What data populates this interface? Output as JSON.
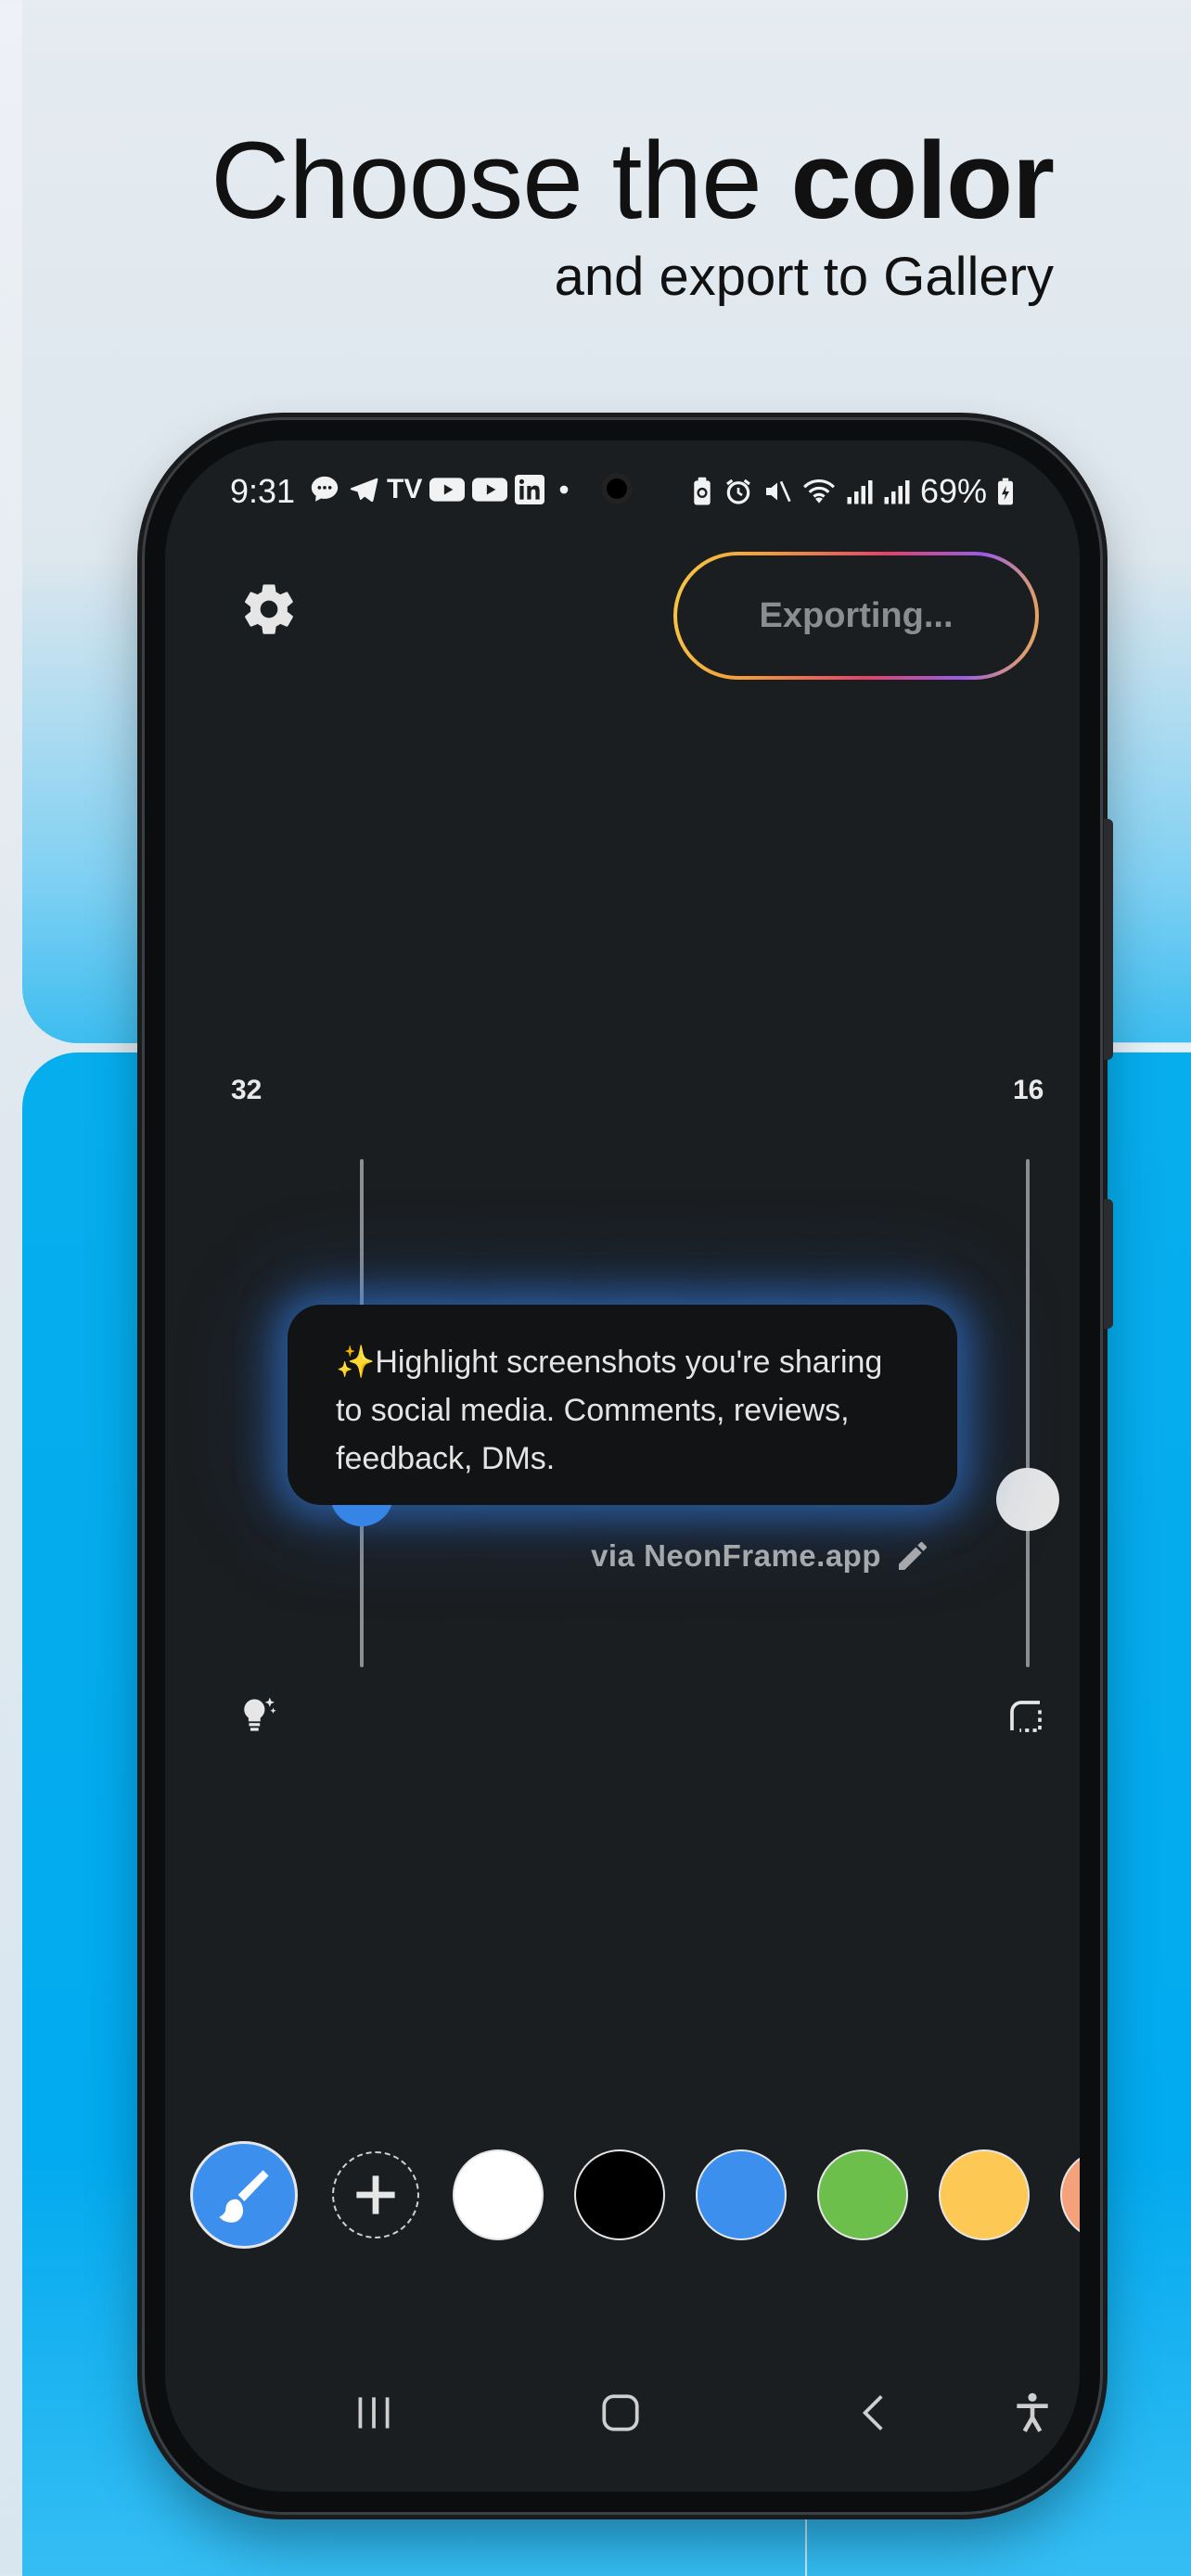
{
  "headline": {
    "line1_regular": "Choose the ",
    "line1_bold": "color",
    "line2": "and export to Gallery"
  },
  "statusbar": {
    "time": "9:31",
    "battery": "69%",
    "left_icons": [
      "chat-icon",
      "telegram-icon",
      "tradingview-icon",
      "youtube-icon",
      "youtube-icon",
      "linkedin-icon",
      "dot-icon"
    ],
    "right_icons": [
      "battery-saver-icon",
      "alarm-icon",
      "mute-icon",
      "wifi-icon",
      "signal-icon",
      "signal-icon",
      "battery-icon"
    ]
  },
  "toolbar": {
    "export_label": "Exporting..."
  },
  "sliders": {
    "left": {
      "value": "32",
      "level": 0.34,
      "thumb_color": "#3d8fee",
      "icon": "bulb-sparkle-icon"
    },
    "right": {
      "value": "16",
      "level": 0.33,
      "thumb_color": "#e6e6e6",
      "icon": "corner-radius-icon"
    }
  },
  "card": {
    "text": "✨Highlight screenshots you're sharing to social media. Comments, reviews, feedback, DMs."
  },
  "via": {
    "label": "via NeonFrame.app",
    "icon": "pencil-icon"
  },
  "palette": {
    "brush_color": "#3d8fee",
    "swatches": [
      "#ffffff",
      "#000000",
      "#3d8fee",
      "#6cbf4b",
      "#fdc853",
      "#f5a27a"
    ]
  },
  "navbar": {
    "icons": [
      "recents-icon",
      "home-icon",
      "back-icon",
      "accessibility-icon"
    ]
  }
}
